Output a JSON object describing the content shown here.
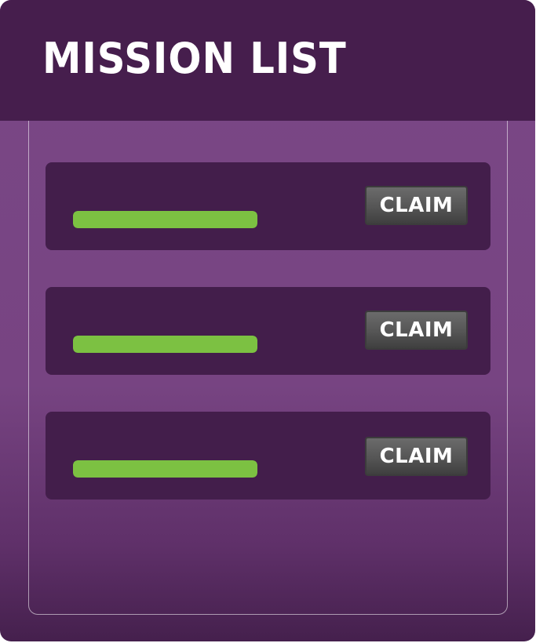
{
  "header": {
    "title": "MISSION LIST"
  },
  "missions": [
    {
      "claim_label": "CLAIM",
      "progress": 1.0
    },
    {
      "claim_label": "CLAIM",
      "progress": 1.0
    },
    {
      "claim_label": "CLAIM",
      "progress": 1.0
    }
  ],
  "colors": {
    "panel": "#774482",
    "header": "#461e4d",
    "card": "#431e4b",
    "progress_fill": "#7cc142",
    "button": "#555555"
  }
}
